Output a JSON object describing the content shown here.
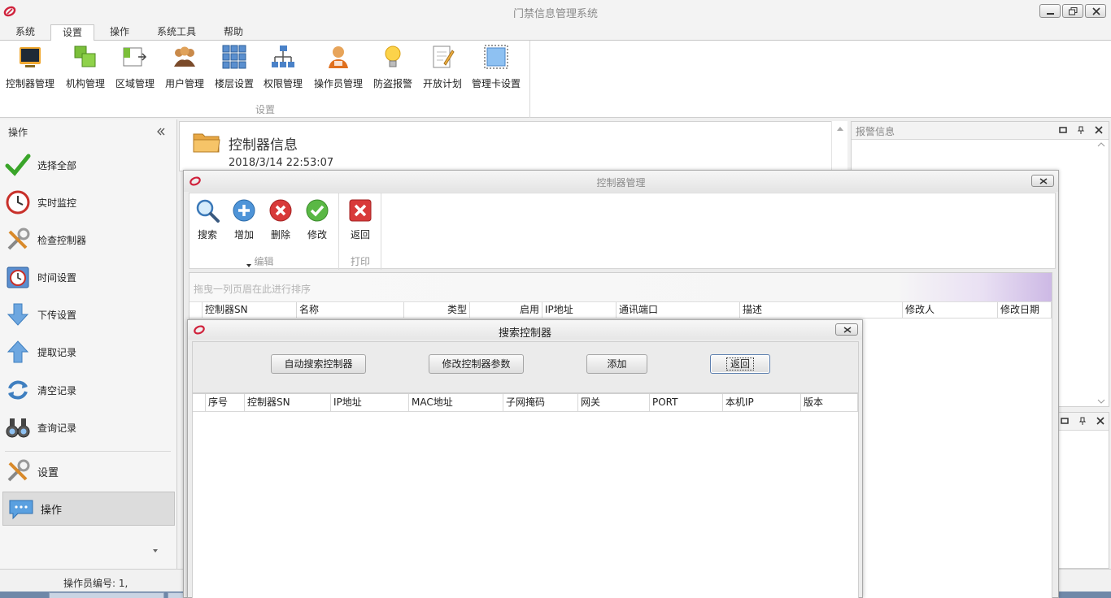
{
  "app": {
    "title": "门禁信息管理系统"
  },
  "menu": {
    "tabs": [
      "系统",
      "设置",
      "操作",
      "系统工具",
      "帮助"
    ],
    "active": "设置"
  },
  "ribbon": {
    "group_label": "设置",
    "items": [
      {
        "label": "控制器管理",
        "icon": "monitor-icon"
      },
      {
        "label": "机构管理",
        "icon": "org-blocks-icon"
      },
      {
        "label": "区域管理",
        "icon": "area-icon"
      },
      {
        "label": "用户管理",
        "icon": "users-icon"
      },
      {
        "label": "楼层设置",
        "icon": "grid-icon"
      },
      {
        "label": "权限管理",
        "icon": "hierarchy-icon"
      },
      {
        "label": "操作员管理",
        "icon": "operator-icon"
      },
      {
        "label": "防盗报警",
        "icon": "bulb-icon"
      },
      {
        "label": "开放计划",
        "icon": "notepad-icon"
      },
      {
        "label": "管理卡设置",
        "icon": "card-icon"
      }
    ]
  },
  "leftnav": {
    "header": "操作",
    "items": [
      {
        "label": "选择全部",
        "icon": "checkmark-icon"
      },
      {
        "label": "实时监控",
        "icon": "clock-icon"
      },
      {
        "label": "检查控制器",
        "icon": "tools-icon"
      },
      {
        "label": "时间设置",
        "icon": "calendar-clock-icon"
      },
      {
        "label": "下传设置",
        "icon": "arrow-down-icon"
      },
      {
        "label": "提取记录",
        "icon": "arrow-up-icon"
      },
      {
        "label": "清空记录",
        "icon": "refresh-icon"
      },
      {
        "label": "查询记录",
        "icon": "binoculars-icon"
      }
    ],
    "bottom_items": [
      {
        "label": "设置",
        "icon": "tools-icon"
      },
      {
        "label": "操作",
        "icon": "chat-bubble-icon"
      }
    ]
  },
  "status": {
    "operator": "操作员编号: 1,"
  },
  "info": {
    "title": "控制器信息",
    "time": "2018/3/14 22:53:07"
  },
  "alarm_panel": {
    "title": "报警信息"
  },
  "controller_window": {
    "title": "控制器管理",
    "groups": [
      {
        "label": "编辑",
        "buttons": [
          {
            "label": "搜索",
            "icon": "magnifier-icon"
          },
          {
            "label": "增加",
            "icon": "plus-circle-icon"
          },
          {
            "label": "删除",
            "icon": "x-circle-icon"
          },
          {
            "label": "修改",
            "icon": "check-circle-icon"
          }
        ]
      },
      {
        "label": "打印",
        "buttons": [
          {
            "label": "返回",
            "icon": "return-icon"
          }
        ]
      }
    ],
    "group_hint": "拖曳一列页眉在此进行排序",
    "columns": [
      "控制器SN",
      "名称",
      "类型",
      "启用",
      "IP地址",
      "通讯端口",
      "描述",
      "修改人",
      "修改日期"
    ]
  },
  "search_dialog": {
    "title": "搜索控制器",
    "buttons": [
      "自动搜索控制器",
      "修改控制器参数",
      "添加",
      "返回"
    ],
    "columns": [
      "序号",
      "控制器SN",
      "IP地址",
      "MAC地址",
      "子网掩码",
      "网关",
      "PORT",
      "本机IP",
      "版本"
    ]
  },
  "colors": {
    "logo": "#d0213b",
    "accent_purple": "#cdb9e5",
    "focus_border": "#5d7fae"
  }
}
